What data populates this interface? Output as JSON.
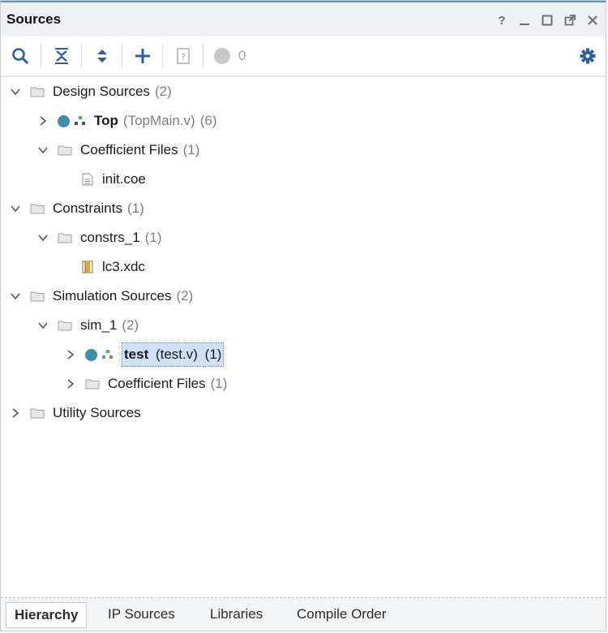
{
  "window": {
    "title": "Sources"
  },
  "title_controls": [
    "help-icon",
    "minimize-icon",
    "maximize-icon",
    "float-icon",
    "close-icon"
  ],
  "toolbar": {
    "search": "search-icon",
    "collapse_all": "collapse-all-icon",
    "expand_all": "expand-all-icon",
    "add": "add-icon",
    "properties": "properties-icon",
    "status_count": "0",
    "settings": "gear-icon"
  },
  "tree": {
    "design_sources": {
      "label": "Design Sources",
      "count": "(2)"
    },
    "top": {
      "label": "Top",
      "file": "(TopMain.v)",
      "count": "(6)"
    },
    "coeff_files_1": {
      "label": "Coefficient Files",
      "count": "(1)"
    },
    "init_coe": {
      "label": "init.coe"
    },
    "constraints": {
      "label": "Constraints",
      "count": "(1)"
    },
    "constrs_1": {
      "label": "constrs_1",
      "count": "(1)"
    },
    "lc3_xdc": {
      "label": "lc3.xdc"
    },
    "sim_sources": {
      "label": "Simulation Sources",
      "count": "(2)"
    },
    "sim_1": {
      "label": "sim_1",
      "count": "(2)"
    },
    "test": {
      "label": "test",
      "file": "(test.v)",
      "count": "(1)"
    },
    "coeff_files_2": {
      "label": "Coefficient Files",
      "count": "(1)"
    },
    "utility_sources": {
      "label": "Utility Sources"
    }
  },
  "tabs": {
    "hierarchy": "Hierarchy",
    "ip_sources": "IP Sources",
    "libraries": "Libraries",
    "compile_order": "Compile Order"
  },
  "colors": {
    "accent": "#2f5f9a",
    "selection": "#cfe0f7",
    "module_dot": "#3f8fa8"
  }
}
